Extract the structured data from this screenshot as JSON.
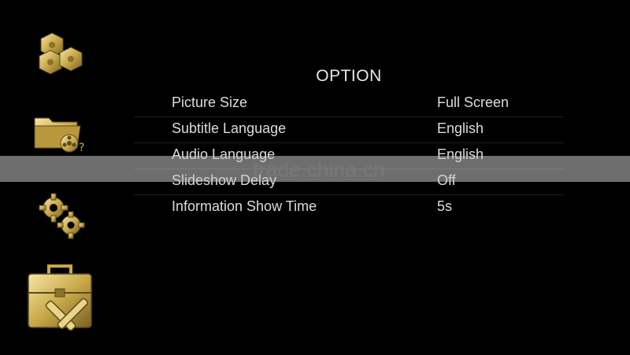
{
  "panel": {
    "title": "OPTION"
  },
  "options": [
    {
      "label": "Picture Size",
      "value": "Full Screen"
    },
    {
      "label": "Subtitle Language",
      "value": "English"
    },
    {
      "label": "Audio Language",
      "value": "English"
    },
    {
      "label": "Slideshow Delay",
      "value": "Off"
    },
    {
      "label": "Information Show Time",
      "value": "5s"
    }
  ],
  "sidebar": {
    "icons": [
      "apps-cubes-icon",
      "media-folder-icon",
      "settings-gears-icon",
      "toolbox-icon"
    ]
  },
  "watermark": {
    "text": "trade.china.cn"
  },
  "colors": {
    "background": "#000000",
    "text": "#dcdcdc",
    "icon_gold": "#c9a94a"
  }
}
